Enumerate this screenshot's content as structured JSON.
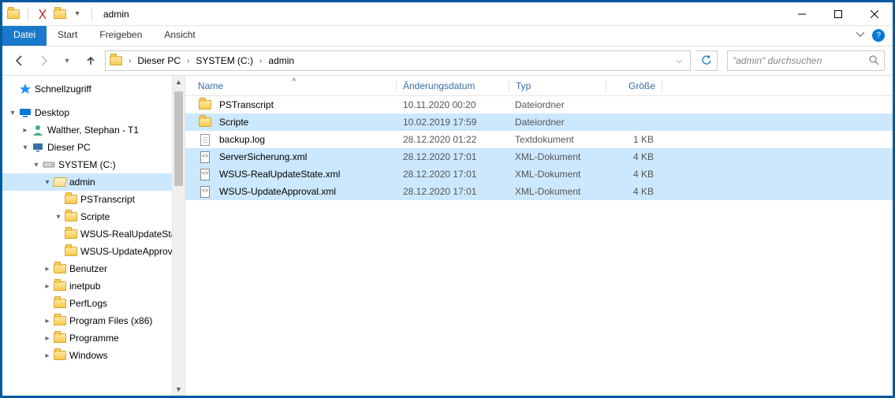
{
  "window_title": "admin",
  "ribbon": {
    "datei": "Datei",
    "start": "Start",
    "freigeben": "Freigeben",
    "ansicht": "Ansicht"
  },
  "breadcrumb": [
    "Dieser PC",
    "SYSTEM (C:)",
    "admin"
  ],
  "search_placeholder": "\"admin\" durchsuchen",
  "columns": {
    "name": "Name",
    "date": "Änderungsdatum",
    "type": "Typ",
    "size": "Größe"
  },
  "nav_tree": [
    {
      "label": "Schnellzugriff",
      "indent": 0,
      "caret": "",
      "icon": "quick",
      "sel": false
    },
    {
      "label": "Desktop",
      "indent": 0,
      "caret": "▾",
      "icon": "desktop",
      "sel": false
    },
    {
      "label": "Walther, Stephan - T1",
      "indent": 1,
      "caret": "▸",
      "icon": "user",
      "sel": false
    },
    {
      "label": "Dieser PC",
      "indent": 1,
      "caret": "▾",
      "icon": "pc",
      "sel": false
    },
    {
      "label": "SYSTEM (C:)",
      "indent": 2,
      "caret": "▾",
      "icon": "drive",
      "sel": false
    },
    {
      "label": "admin",
      "indent": 3,
      "caret": "▾",
      "icon": "folder-open",
      "sel": true
    },
    {
      "label": "PSTranscript",
      "indent": 4,
      "caret": "",
      "icon": "folder",
      "sel": false
    },
    {
      "label": "Scripte",
      "indent": 4,
      "caret": "▾",
      "icon": "folder",
      "sel": false
    },
    {
      "label": "WSUS-RealUpdateState",
      "indent": 4,
      "caret": "",
      "icon": "folder",
      "sel": false
    },
    {
      "label": "WSUS-UpdateApproval",
      "indent": 4,
      "caret": "",
      "icon": "folder",
      "sel": false
    },
    {
      "label": "Benutzer",
      "indent": 3,
      "caret": "▸",
      "icon": "folder",
      "sel": false
    },
    {
      "label": "inetpub",
      "indent": 3,
      "caret": "▸",
      "icon": "folder",
      "sel": false
    },
    {
      "label": "PerfLogs",
      "indent": 3,
      "caret": "",
      "icon": "folder",
      "sel": false
    },
    {
      "label": "Program Files (x86)",
      "indent": 3,
      "caret": "▸",
      "icon": "folder",
      "sel": false
    },
    {
      "label": "Programme",
      "indent": 3,
      "caret": "▸",
      "icon": "folder",
      "sel": false
    },
    {
      "label": "Windows",
      "indent": 3,
      "caret": "▸",
      "icon": "folder",
      "sel": false
    }
  ],
  "files": [
    {
      "name": "PSTranscript",
      "date": "10.11.2020 00:20",
      "type": "Dateiordner",
      "size": "",
      "icon": "folder",
      "sel": false
    },
    {
      "name": "Scripte",
      "date": "10.02.2019 17:59",
      "type": "Dateiordner",
      "size": "",
      "icon": "folder",
      "sel": true
    },
    {
      "name": "backup.log",
      "date": "28.12.2020 01:22",
      "type": "Textdokument",
      "size": "1 KB",
      "icon": "file",
      "sel": false
    },
    {
      "name": "ServerSicherung.xml",
      "date": "28.12.2020 17:01",
      "type": "XML-Dokument",
      "size": "4 KB",
      "icon": "xml",
      "sel": true
    },
    {
      "name": "WSUS-RealUpdateState.xml",
      "date": "28.12.2020 17:01",
      "type": "XML-Dokument",
      "size": "4 KB",
      "icon": "xml",
      "sel": true
    },
    {
      "name": "WSUS-UpdateApproval.xml",
      "date": "28.12.2020 17:01",
      "type": "XML-Dokument",
      "size": "4 KB",
      "icon": "xml",
      "sel": true
    }
  ]
}
